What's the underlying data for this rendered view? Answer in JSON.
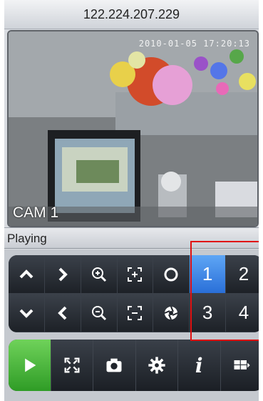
{
  "header": {
    "title": "122.224.207.229"
  },
  "video": {
    "camera_label": "CAM 1",
    "timestamp": "2010-01-05 17:20:13"
  },
  "status": {
    "text": "Playing"
  },
  "ptz": {
    "channels": [
      "1",
      "2",
      "3",
      "4"
    ],
    "selected_channel": "1"
  },
  "colors": {
    "accent_blue": "#2a6fd8",
    "play_green": "#2f9c26",
    "highlight_red": "#e01010"
  },
  "icons": {
    "up": "chevron-up-icon",
    "right": "chevron-right-icon",
    "down": "chevron-down-icon",
    "left": "chevron-left-icon",
    "zoom_in": "zoom-in-icon",
    "zoom_out": "zoom-out-icon",
    "focus_near": "focus-near-icon",
    "focus_far": "focus-far-icon",
    "iris_open": "iris-open-icon",
    "iris_close": "iris-close-icon",
    "play": "play-icon",
    "fullscreen": "fullscreen-icon",
    "snapshot": "camera-icon",
    "settings": "gear-icon",
    "info": "info-icon",
    "layout": "layout-icon"
  },
  "toolbar": {
    "info_glyph": "i"
  }
}
